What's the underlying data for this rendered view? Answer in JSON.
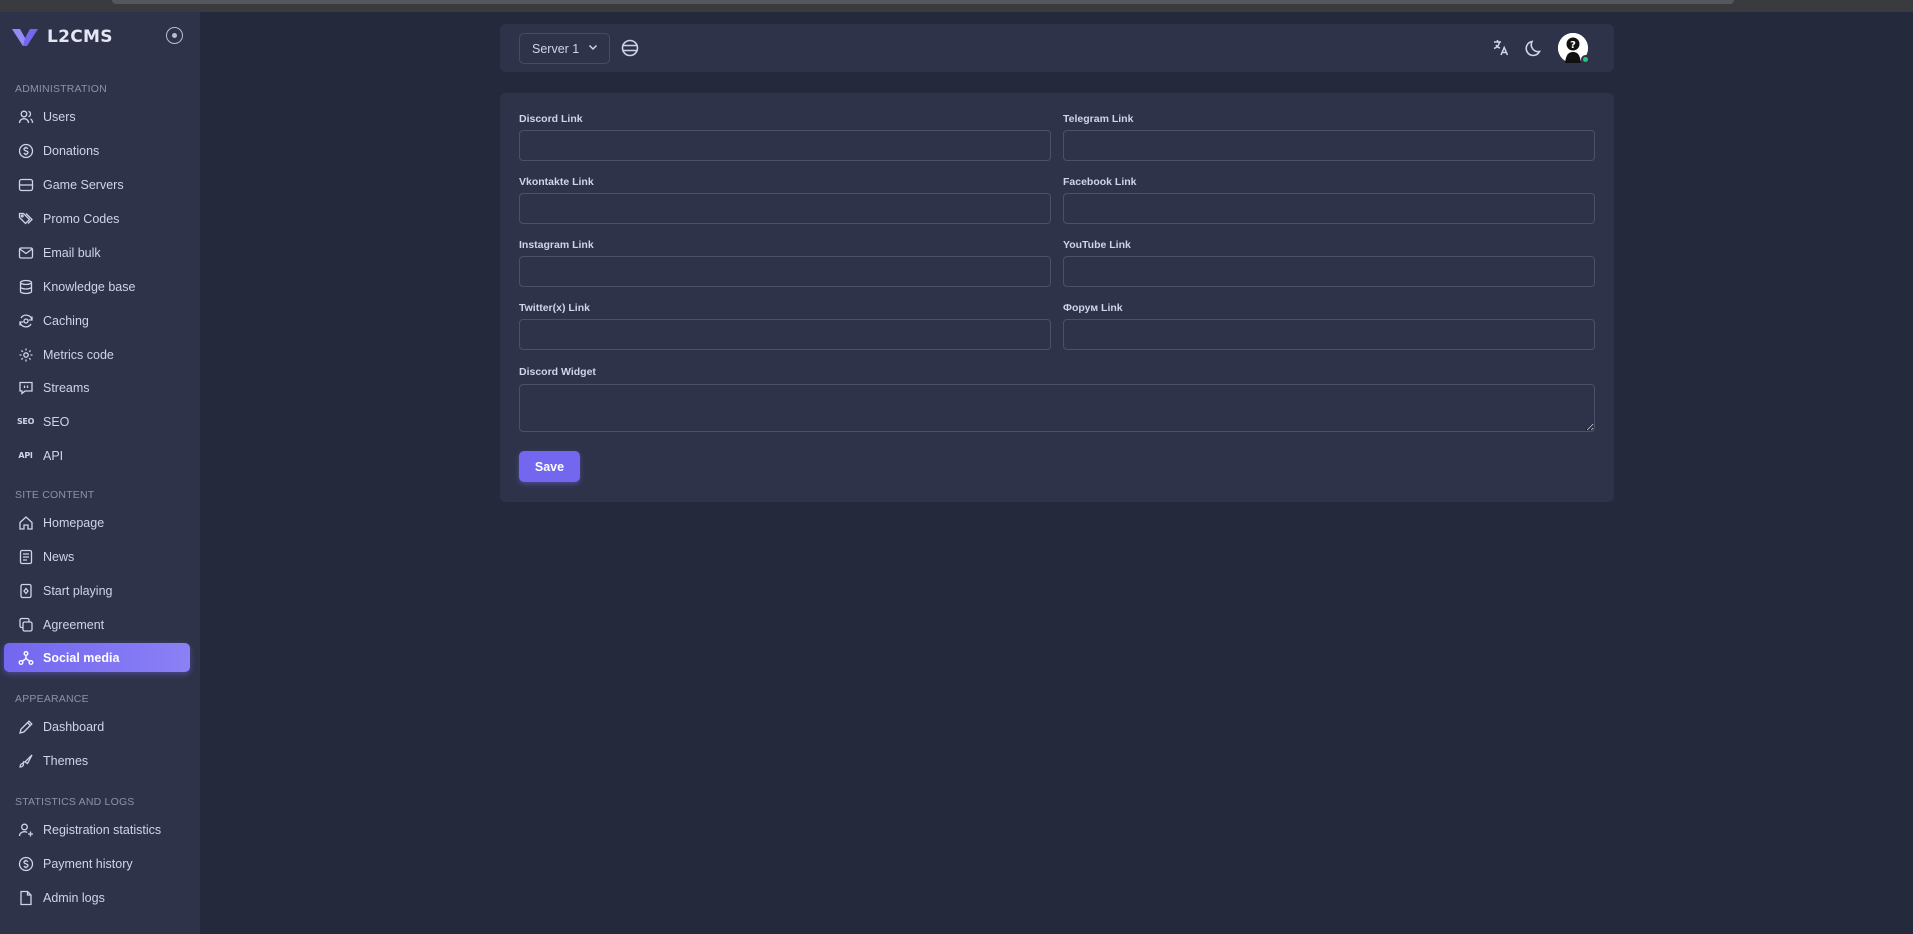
{
  "app": {
    "name": "L2CMS",
    "brand_color": "#7367f0"
  },
  "sidebar": {
    "sections": [
      {
        "title": "ADMINISTRATION",
        "items": [
          {
            "label": "Users",
            "icon": "users-icon"
          },
          {
            "label": "Donations",
            "icon": "dollar-circle-icon"
          },
          {
            "label": "Game Servers",
            "icon": "server-icon"
          },
          {
            "label": "Promo Codes",
            "icon": "tags-icon"
          },
          {
            "label": "Email bulk",
            "icon": "mail-icon"
          },
          {
            "label": "Knowledge base",
            "icon": "database-icon"
          },
          {
            "label": "Caching",
            "icon": "cache-icon"
          },
          {
            "label": "Metrics code",
            "icon": "metrics-icon"
          },
          {
            "label": "Streams",
            "icon": "message-icon"
          },
          {
            "label": "SEO",
            "icon": "seo-icon"
          },
          {
            "label": "API",
            "icon": "api-icon"
          }
        ]
      },
      {
        "title": "SITE CONTENT",
        "items": [
          {
            "label": "Homepage",
            "icon": "home-icon"
          },
          {
            "label": "News",
            "icon": "news-icon"
          },
          {
            "label": "Start playing",
            "icon": "play-card-icon"
          },
          {
            "label": "Agreement",
            "icon": "copy-icon"
          },
          {
            "label": "Social media",
            "icon": "share-network-icon",
            "active": true
          }
        ]
      },
      {
        "title": "APPEARANCE",
        "items": [
          {
            "label": "Dashboard",
            "icon": "pencil-icon"
          },
          {
            "label": "Themes",
            "icon": "brush-icon"
          }
        ]
      },
      {
        "title": "STATISTICS AND LOGS",
        "items": [
          {
            "label": "Registration statistics",
            "icon": "user-plus-icon"
          },
          {
            "label": "Payment history",
            "icon": "dollar-circle-icon"
          },
          {
            "label": "Admin logs",
            "icon": "file-icon"
          }
        ]
      }
    ]
  },
  "navbar": {
    "server_select": {
      "value": "Server 1"
    },
    "icons": [
      "globe-icon",
      "translate-icon",
      "moon-icon",
      "avatar"
    ]
  },
  "form": {
    "fields": [
      {
        "label": "Discord Link",
        "value": ""
      },
      {
        "label": "Telegram Link",
        "value": ""
      },
      {
        "label": "Vkontakte Link",
        "value": ""
      },
      {
        "label": "Facebook Link",
        "value": ""
      },
      {
        "label": "Instagram Link",
        "value": ""
      },
      {
        "label": "YouTube Link",
        "value": ""
      },
      {
        "label": "Twitter(x) Link",
        "value": ""
      },
      {
        "label": "Форум Link",
        "value": ""
      }
    ],
    "widget": {
      "label": "Discord Widget",
      "value": ""
    },
    "save_label": "Save"
  }
}
